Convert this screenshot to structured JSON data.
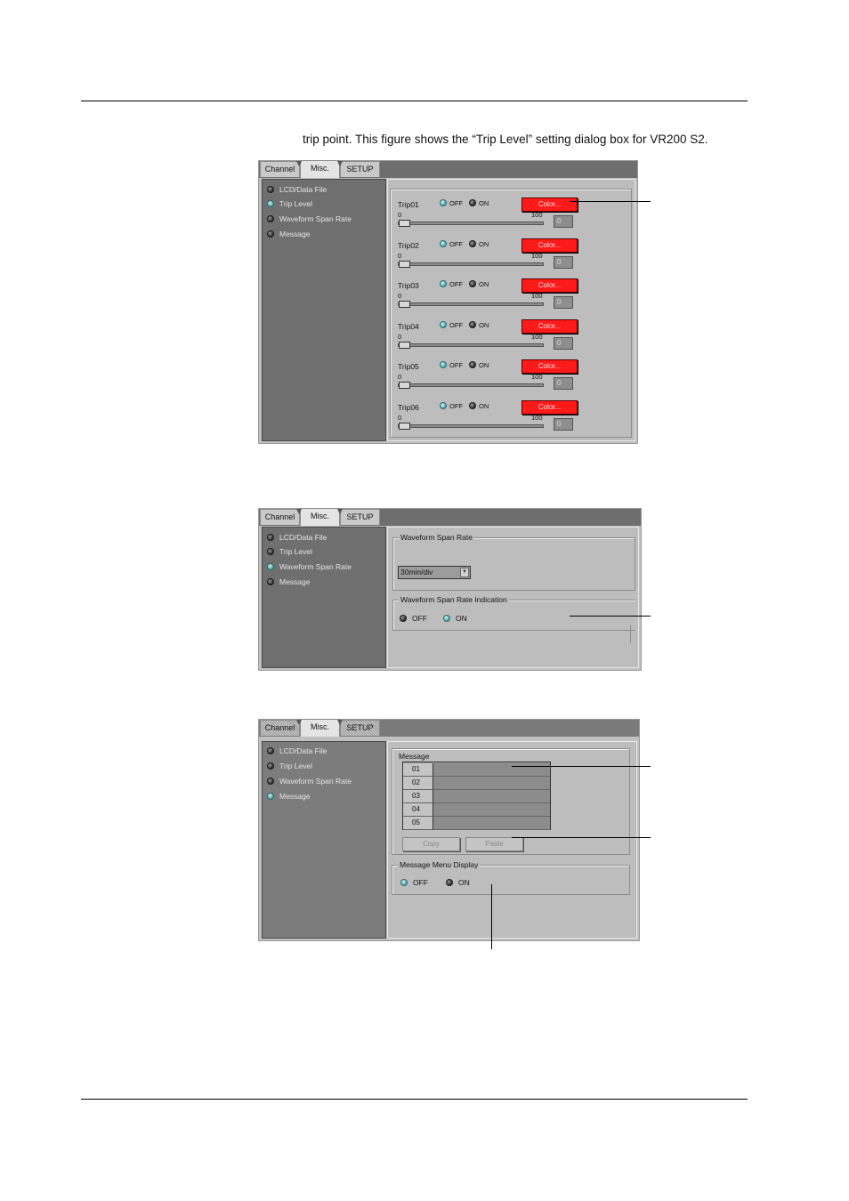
{
  "page": {
    "intro_text": "trip point.  This figure shows the “Trip Level” setting dialog box for VR200 S2."
  },
  "tabs": [
    "Channel",
    "Misc.",
    "SETUP"
  ],
  "side_items": [
    "LCD/Data File",
    "Trip Level",
    "Waveform Span Rate",
    "Message"
  ],
  "dialog1": {
    "active_item": "Trip Level",
    "off_label": "OFF",
    "on_label": "ON",
    "trips": [
      {
        "name": "Trip01",
        "state": "OFF",
        "color_label": "Color...",
        "min": "0",
        "max": "100",
        "value": "0",
        "color": "#ff1a1a"
      },
      {
        "name": "Trip02",
        "state": "OFF",
        "color_label": "Color...",
        "min": "0",
        "max": "100",
        "value": "0",
        "color": "#ff1a1a"
      },
      {
        "name": "Trip03",
        "state": "OFF",
        "color_label": "Color...",
        "min": "0",
        "max": "100",
        "value": "0",
        "color": "#ff1a1a"
      },
      {
        "name": "Trip04",
        "state": "OFF",
        "color_label": "Color...",
        "min": "0",
        "max": "100",
        "value": "0",
        "color": "#ff1a1a"
      },
      {
        "name": "Trip05",
        "state": "OFF",
        "color_label": "Color...",
        "min": "0",
        "max": "100",
        "value": "0",
        "color": "#ff1a1a"
      },
      {
        "name": "Trip06",
        "state": "OFF",
        "color_label": "Color...",
        "min": "0",
        "max": "100",
        "value": "0",
        "color": "#ff1a1a"
      }
    ]
  },
  "dialog2": {
    "active_item": "Waveform Span Rate",
    "span_group_title": "Waveform Span Rate",
    "span_value": "30min/div",
    "indication_group_title": "Waveform Span Rate Indication",
    "off_label": "OFF",
    "on_label": "ON",
    "indication_state": "ON"
  },
  "dialog3": {
    "active_item": "Message",
    "message_group_title": "Message",
    "rows": [
      {
        "num": "01",
        "text": ""
      },
      {
        "num": "02",
        "text": ""
      },
      {
        "num": "03",
        "text": ""
      },
      {
        "num": "04",
        "text": ""
      },
      {
        "num": "05",
        "text": ""
      }
    ],
    "copy_label": "Copy",
    "paste_label": "Paste",
    "menu_group_title": "Message Menu Display",
    "off_label": "OFF",
    "on_label": "ON",
    "menu_state": "OFF"
  }
}
